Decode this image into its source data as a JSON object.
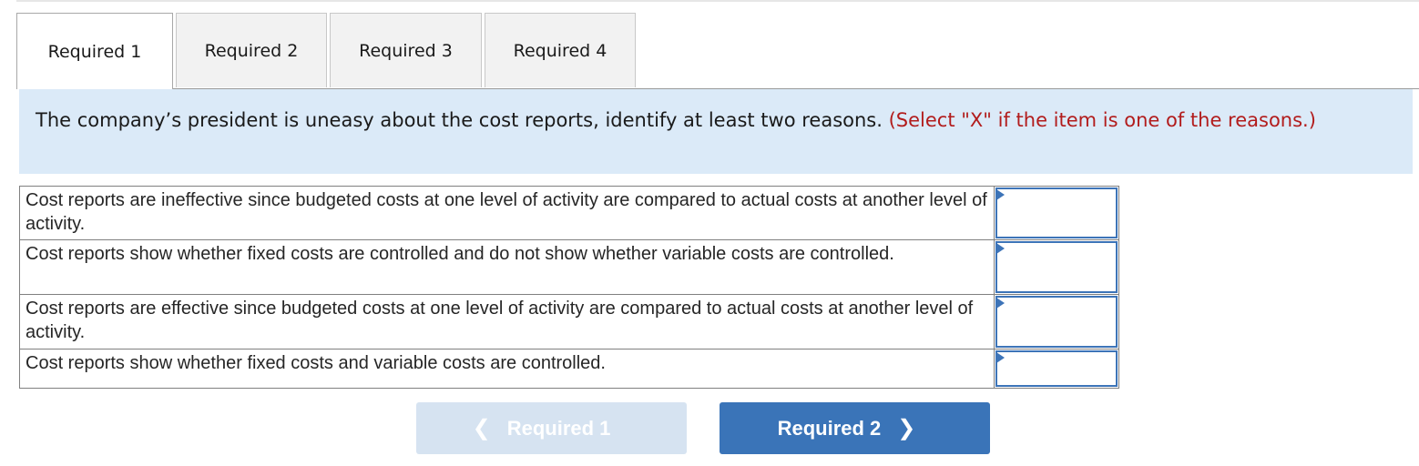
{
  "tabs": [
    {
      "label": "Required 1",
      "active": true
    },
    {
      "label": "Required 2",
      "active": false
    },
    {
      "label": "Required 3",
      "active": false
    },
    {
      "label": "Required 4",
      "active": false
    }
  ],
  "instruction": {
    "text": "The company’s president is uneasy about the cost reports, identify at least two reasons.",
    "note": "(Select \"X\" if the item is one of the reasons.)"
  },
  "items": [
    {
      "text": "Cost reports are ineffective since budgeted costs at one level of activity are compared to actual costs at another level of activity.",
      "value": ""
    },
    {
      "text": "Cost reports show whether fixed costs are controlled and do not show whether variable costs are controlled.",
      "value": ""
    },
    {
      "text": "Cost reports are effective since budgeted costs at one level of activity are compared to actual costs at another level of activity.",
      "value": ""
    },
    {
      "text": "Cost reports show whether fixed costs and variable costs are controlled.",
      "value": ""
    }
  ],
  "nav": {
    "prev_label": "Required 1",
    "next_label": "Required 2",
    "prev_icon": "chevron-left-icon",
    "next_icon": "chevron-right-icon"
  },
  "colors": {
    "accent": "#3a74b8",
    "disabled_button": "#d6e3f1",
    "instruction_bg": "#dbeaf8",
    "note_red": "#b21c1c"
  }
}
